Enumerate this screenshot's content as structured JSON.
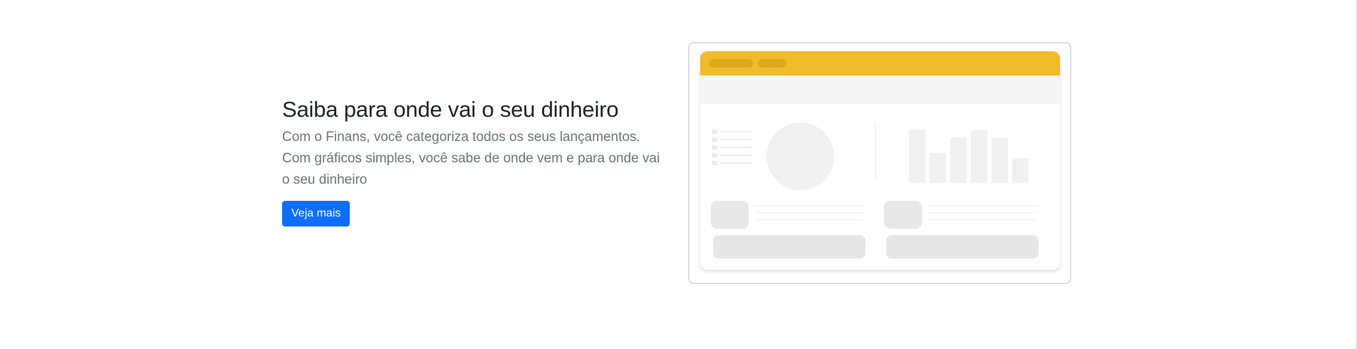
{
  "hero": {
    "title": "Saiba para onde vai o seu dinheiro",
    "description": "Com o Finans, você categoriza todos os seus lançamentos. Com gráficos simples, você sabe de onde vem e para onde vai o seu dinheiro",
    "cta_label": "Veja mais"
  },
  "colors": {
    "accent": "#0d6efd",
    "mockup_header": "#f0bc2b",
    "placeholder": "#f1f1f1"
  },
  "illustration": {
    "bar_levels": [
      0.85,
      0.48,
      0.73,
      0.84,
      0.72,
      0.4
    ]
  }
}
